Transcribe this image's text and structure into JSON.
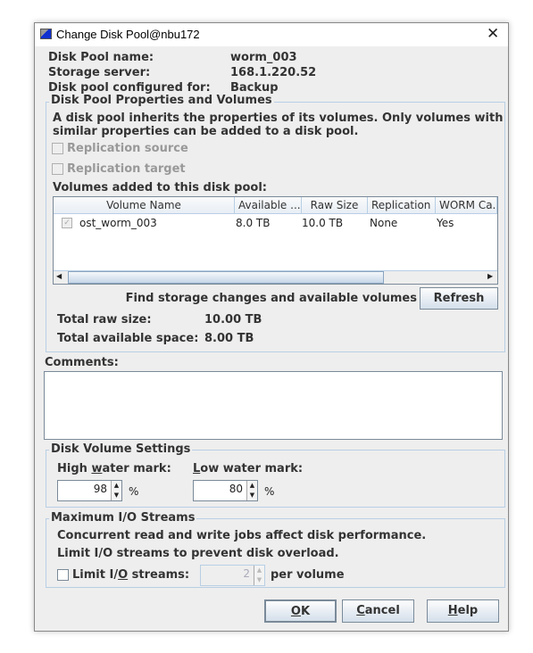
{
  "window": {
    "title": "Change Disk Pool@nbu172",
    "close": "✕"
  },
  "info": [
    {
      "label": "Disk Pool name:",
      "value": "worm_003"
    },
    {
      "label": "Storage server:",
      "value": "168.1.220.52"
    },
    {
      "label": "Disk pool configured for:",
      "value": "Backup"
    }
  ],
  "properties": {
    "legend": "Disk Pool Properties and Volumes",
    "desc1": "A disk pool inherits the properties of its volumes. Only volumes with",
    "desc2": "similar properties can be added to a disk pool.",
    "replication_source": {
      "label": "Replication source",
      "checked": false,
      "enabled": false
    },
    "replication_target": {
      "label": "Replication target",
      "checked": false,
      "enabled": false
    },
    "volumes_label": "Volumes added to this disk pool:",
    "table": {
      "columns": [
        "Volume Name",
        "Available ...",
        "Raw Size",
        "Replication",
        "WORM Ca..."
      ],
      "rows": [
        {
          "checked": true,
          "name": "ost_worm_003",
          "available": "8.0 TB",
          "raw": "10.0 TB",
          "replication": "None",
          "worm": "Yes"
        }
      ]
    },
    "find_label": "Find storage changes and available volumes",
    "refresh": "Refresh",
    "total_raw_label": "Total raw size:",
    "total_raw": "10.00 TB",
    "total_avail_label": "Total available space:",
    "total_avail": "8.00 TB"
  },
  "comments": {
    "label": "Comments:",
    "value": ""
  },
  "volume_settings": {
    "legend": "Disk Volume Settings",
    "high": {
      "pre": "High ",
      "mn": "w",
      "post": "ater mark:",
      "value": "98",
      "unit": "%"
    },
    "low": {
      "pre": "",
      "mn": "L",
      "post": "ow water mark:",
      "value": "80",
      "unit": "%"
    }
  },
  "io": {
    "legend": "Maximum I/O Streams",
    "line1": "Concurrent read and write jobs affect disk performance.",
    "line2": "Limit I/O streams to prevent disk overload.",
    "limit": {
      "pre": "Limit I/",
      "mn": "O",
      "post": " streams:",
      "checked": false,
      "value": "2",
      "suffix": "per volume"
    }
  },
  "buttons": {
    "ok": {
      "pre": "",
      "mn": "O",
      "post": "K"
    },
    "cancel": {
      "pre": "",
      "mn": "C",
      "post": "ancel"
    },
    "help": {
      "pre": "",
      "mn": "H",
      "post": "elp"
    }
  }
}
